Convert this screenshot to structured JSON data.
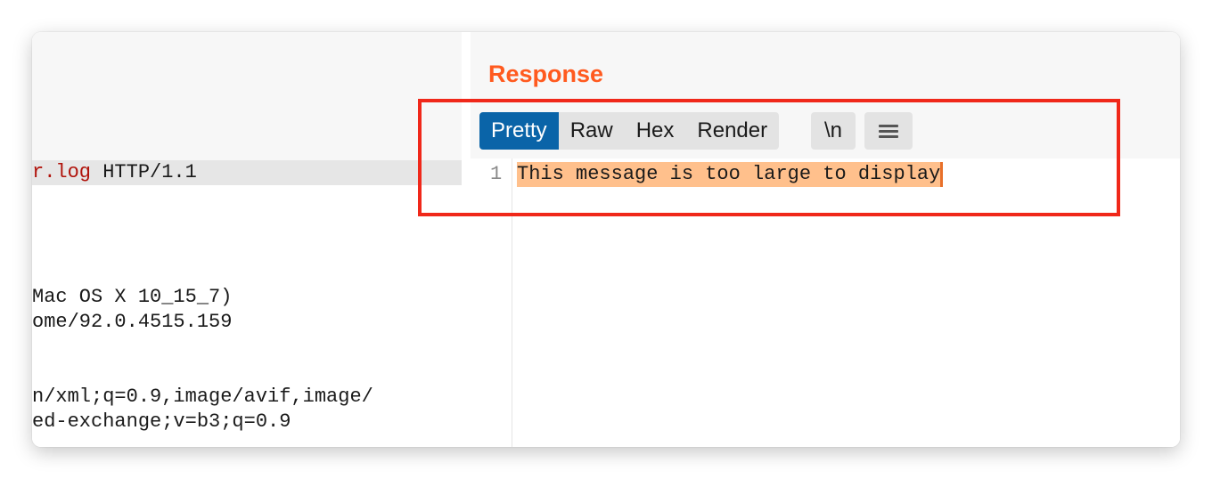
{
  "request": {
    "lines": [
      {
        "path_part": "r.log",
        "rest": " HTTP/1.1"
      },
      {
        "text": "Mac OS X 10_15_7)"
      },
      {
        "text": "ome/92.0.4515.159"
      },
      {
        "text": "n/xml;q=0.9,image/avif,image/"
      },
      {
        "text": "ed-exchange;v=b3;q=0.9"
      }
    ]
  },
  "response": {
    "title": "Response",
    "tabs": [
      {
        "label": "Pretty",
        "active": true
      },
      {
        "label": "Raw",
        "active": false
      },
      {
        "label": "Hex",
        "active": false
      },
      {
        "label": "Render",
        "active": false
      }
    ],
    "newline_label": "\\n",
    "menu_icon": "hamburger-menu-icon",
    "line_number": "1",
    "message": "This message is too large to display"
  },
  "colors": {
    "accent": "#ff5a1f",
    "active_tab": "#0a64a8",
    "highlight": "#ffc08c",
    "annotation": "#f0281a",
    "request_path": "#b0120a"
  }
}
